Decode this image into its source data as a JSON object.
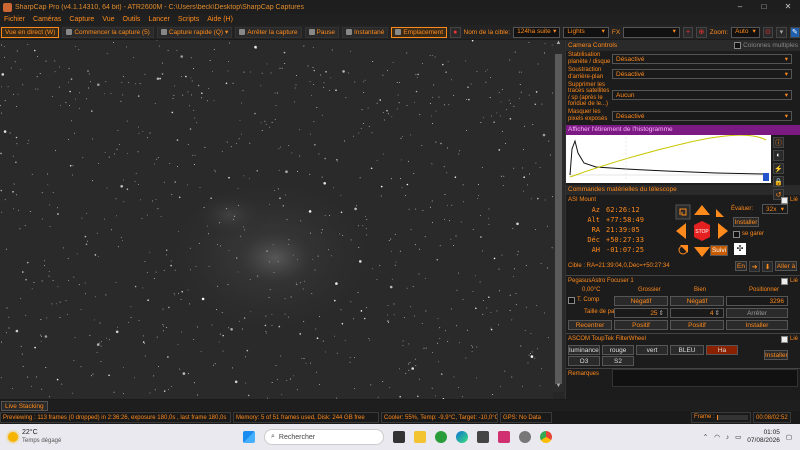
{
  "titlebar": {
    "title": "SharpCap Pro (v4.1.14310, 64 bit) - ATR2600M - C:\\Users\\beck\\Desktop\\SharpCap Captures",
    "minimize": "–",
    "maximize": "□",
    "close": "✕"
  },
  "menu": [
    "Fichier",
    "Caméras",
    "Capture",
    "Vue",
    "Outils",
    "Lancer",
    "Scripts",
    "Aide (H)"
  ],
  "toolbar": {
    "live_view": "Vue en direct (W)",
    "start_capture": "Commencer la capture (5)",
    "quick_capture": "Capture rapide (Q)",
    "stop_capture": "Arrêter la capture",
    "pause": "Pause",
    "snapshot": "Instantané",
    "placement": "Emplacement",
    "target_label": "Nom de la cible:",
    "target_value": "124ha suite",
    "frame_type": "Lights",
    "fx_label": "FX",
    "zoom_label": "Zoom:",
    "zoom_value": "Auto"
  },
  "camera_controls": {
    "title": "Camera Controls",
    "multi_col": "Colonnes multiples",
    "rows": [
      {
        "label": "Stabilisation planète / disque",
        "value": "Désactivé"
      },
      {
        "label": "Soustraction d'arrière-plan",
        "value": "Désactivé"
      },
      {
        "label": "Supprimer les traces satellites / sp (après le fondue de le...)",
        "value": "Aucun"
      },
      {
        "label": "Masquer les pixels exposés",
        "value": "Désactivé"
      }
    ],
    "first_row_value": "Désactivé"
  },
  "histogram": {
    "title": "Afficher l'étirement de l'histogramme"
  },
  "telescope": {
    "title": "Commandes matérielles du télescope",
    "mount_name": "ASI Mount",
    "linked": "Lié",
    "az_label": "Az",
    "az": "62:26:12",
    "alt_label": "Alt",
    "alt": "+77:58:49",
    "ra_label": "RA",
    "ra": "21:39:05",
    "dec_label": "Déc",
    "dec": "+50:27:33",
    "ah_label": "AH",
    "ah": "-01:07:25",
    "rate_label": "Évaluer:",
    "rate": "32x",
    "install": "Installer",
    "park": "se garer",
    "follow": "Suivi",
    "stop": "STOP",
    "target_line": "Cible : RA=21:39:04,0,Dec=+50:27:34",
    "en": "En",
    "goto": "Aller à"
  },
  "focuser": {
    "name": "PegasusAstro Focuser 1",
    "linked": "Lié",
    "temp": "0,00°C",
    "col_coarse": "Grossier",
    "col_fine": "Bien",
    "col_position": "Positionner",
    "tcomp": "T. Comp",
    "neg1": "Négatif",
    "neg2": "Négatif",
    "position_value": "3296",
    "step_label": "Taille de pas",
    "step_coarse": "25",
    "step_fine": "4",
    "stop": "Arrêter",
    "recenter": "Recentrer",
    "pos1": "Positif",
    "pos2": "Positif",
    "install": "Installer"
  },
  "filterwheel": {
    "name": "ASCOM ToupTek FilterWheel",
    "linked": "Lié",
    "filters": [
      "luminance",
      "rouge",
      "vert",
      "BLEU",
      "Ha"
    ],
    "filters_row2": [
      "O3",
      "S2"
    ],
    "install": "Installer",
    "selected": "Ha"
  },
  "remarks": "Remarques",
  "live_stacking": "Live Stacking",
  "status": {
    "previewing": "Previewing : 113 frames (0 dropped) in 2:36:26, exposure 180,0s , last frame 180,0s",
    "memory": "Memory: 5 of 51 frames used, Disk: 244 GB free",
    "cooler": "Cooler: 55%, Temp: -9,9°C, Target: -10,0°C",
    "gps": "GPS: No Data",
    "frame_label": "Frame :",
    "frame_time": "00:08/02:52"
  },
  "taskbar": {
    "temperature": "22°C",
    "weather": "Temps dégagé",
    "search": "Rechercher",
    "time": "01:05",
    "date": "07/08/2026"
  },
  "colors": {
    "accent": "#ff8a1c",
    "purple": "#7b1a83",
    "stop_red": "#e52020"
  },
  "icons": [
    "app-icon",
    "camera-icon",
    "pause-icon",
    "search-icon",
    "windows-start-icon",
    "wifi-icon",
    "speaker-icon",
    "battery-icon"
  ]
}
